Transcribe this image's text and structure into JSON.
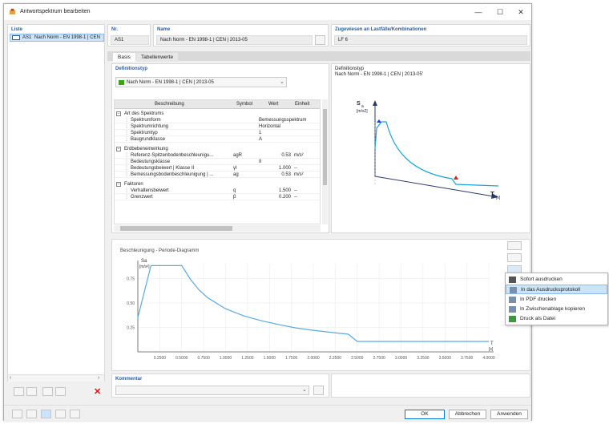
{
  "window": {
    "title": "Antwortspektrum bearbeiten",
    "controls": [
      "—",
      "☐",
      "✕"
    ]
  },
  "list": {
    "header": "Liste",
    "items": [
      {
        "code": "AS1",
        "label": "Nach Norm - EN 1998-1 | CEN"
      }
    ]
  },
  "meta": {
    "nr_label": "Nr.",
    "nr_value": "AS1",
    "name_label": "Name",
    "name_value": "Nach Norm - EN 1998-1 | CEN | 2013-05",
    "assigned_label": "Zugewiesen an Lastfälle/Kombinationen",
    "assigned_value": "LF 6"
  },
  "tabs": [
    "Basis",
    "Tabellenwerte"
  ],
  "defType": {
    "label": "Definitionstyp",
    "value": "Nach Norm - EN 1998-1 | CEN | 2013-05",
    "color": "#3aa317"
  },
  "preview": {
    "label": "Definitionstyp",
    "value": "Nach Norm - EN 1998-1 | CEN | 2013-05'",
    "y_axis": "S",
    "y_sub": "a",
    "y_unit": "[m/s2]",
    "x_axis": "T",
    "x_unit": "[s]"
  },
  "table": {
    "columns": [
      "Beschreibung",
      "Symbol",
      "Wert",
      "Einheit"
    ],
    "rows": [
      {
        "type": "group",
        "desc": "Art des Spektrums"
      },
      {
        "type": "item",
        "desc": "Spektrumform",
        "sym": "",
        "val": "Bemessungsspektrum",
        "unit": ""
      },
      {
        "type": "item",
        "desc": "Spektrumrichtung",
        "sym": "",
        "val": "Horizontal",
        "unit": ""
      },
      {
        "type": "item",
        "desc": "Spektrumtyp",
        "sym": "",
        "val": "1",
        "unit": ""
      },
      {
        "type": "item",
        "desc": "Baugrundklasse",
        "sym": "",
        "val": "A",
        "unit": ""
      },
      {
        "type": "gap"
      },
      {
        "type": "group",
        "desc": "Erdbebeneinwirkung"
      },
      {
        "type": "item",
        "desc": "Referenz-Spitzenbodenbeschleunigu...",
        "sym": "agR",
        "val": "0.53",
        "unit": "m/s²",
        "num": true
      },
      {
        "type": "item",
        "desc": "Bedeutungsklasse",
        "sym": "",
        "val": "II",
        "unit": ""
      },
      {
        "type": "item",
        "desc": "Bedeutungsbeiwert | Klasse II",
        "sym": "γI",
        "val": "1.000",
        "unit": "--",
        "num": true
      },
      {
        "type": "item",
        "desc": "Bemessungsbodenbeschleunigung | ...",
        "sym": "ag",
        "val": "0.53",
        "unit": "m/s²",
        "num": true
      },
      {
        "type": "gap"
      },
      {
        "type": "group",
        "desc": "Faktoren"
      },
      {
        "type": "item",
        "desc": "Verhaltensbeiwert",
        "sym": "q",
        "val": "1.500",
        "unit": "--",
        "num": true
      },
      {
        "type": "item",
        "desc": "Grenzwert",
        "sym": "β",
        "val": "0.200",
        "unit": "--",
        "num": true
      }
    ]
  },
  "diagram": {
    "title": "Beschleunigung - Periode-Diagramm",
    "y_label": "Sa",
    "y_unit": "[m/s²]",
    "x_label": "T",
    "x_unit": "[s]"
  },
  "chart_data": {
    "type": "line",
    "xlabel": "T [s]",
    "ylabel": "Sa [m/s²]",
    "xlim": [
      0,
      4.0
    ],
    "ylim": [
      0,
      0.9
    ],
    "xticks": [
      "0.2500",
      "0.5000",
      "0.7500",
      "1.0000",
      "1.2500",
      "1.5000",
      "1.7500",
      "2.0000",
      "2.2500",
      "2.5000",
      "2.7500",
      "3.0000",
      "3.2500",
      "3.5000",
      "3.7500",
      "4.0000"
    ],
    "yticks": [
      "0.25",
      "0.50",
      "0.75"
    ],
    "series": [
      {
        "color": "#5aa9e0",
        "x": [
          0,
          0.15,
          0.4,
          0.5,
          0.6,
          0.7,
          0.8,
          1.0,
          1.2,
          1.4,
          1.6,
          1.8,
          2.0,
          2.2,
          2.4,
          2.5,
          2.6,
          3.0,
          3.5,
          4.0
        ],
        "y": [
          0.35,
          0.88,
          0.88,
          0.88,
          0.74,
          0.63,
          0.55,
          0.44,
          0.37,
          0.32,
          0.28,
          0.245,
          0.22,
          0.2,
          0.18,
          0.106,
          0.106,
          0.106,
          0.106,
          0.106
        ]
      }
    ]
  },
  "menu": {
    "items": [
      {
        "label": "Sofort ausdrucken",
        "icon": "printer-icon",
        "hl": false
      },
      {
        "label": "In das Ausdrucksprotokoll",
        "icon": "report-icon",
        "hl": true
      },
      {
        "label": "In PDF drucken",
        "icon": "pdf-icon",
        "hl": false
      },
      {
        "label": "In Zwischenablage kopieren",
        "icon": "clipboard-icon",
        "hl": false
      },
      {
        "label": "Druck als Datei",
        "icon": "file-icon",
        "hl": false
      }
    ]
  },
  "comment": {
    "label": "Kommentar"
  },
  "buttons": {
    "ok": "OK",
    "cancel": "Abbrechen",
    "apply": "Anwenden"
  }
}
